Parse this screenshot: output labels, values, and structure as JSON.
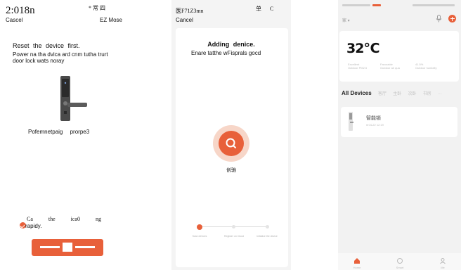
{
  "screen1": {
    "clock": "2:018n",
    "status_right": "* 常 四",
    "cancel": "Cascel",
    "mode": "EZ Mose",
    "title": "Reset the device first.",
    "description": "Power na tha dvica ard cnm tutha trurt door lock wats noray",
    "caption": "Pofemnetpaig prorpe3",
    "consent_line1": "Ca the ica0 ng",
    "consent_line2": "rapidy.",
    "accent": "#e8603a",
    "lock_icon": "door-lock-icon"
  },
  "screen2": {
    "status_left": "医F71Z3mn",
    "status_right": "单 C",
    "cancel": "Cancel",
    "title": "Adding denice.",
    "description": "Enare tatthe wFisprals gocd",
    "status_text": "创驰",
    "steps": [
      "Scan devices",
      "Register on Cloud",
      "Initialize the device"
    ],
    "progress_step": 1,
    "accent": "#e8603a"
  },
  "screen3": {
    "temperature": "32℃",
    "home_selector": "家 ▾",
    "weather": [
      {
        "value": "Excellent",
        "label": "Outdoor PM2.5"
      },
      {
        "value": "Favorable",
        "label": "Outdoor air qua"
      },
      {
        "value": "41.5%",
        "label": "Outdoor humidity"
      }
    ],
    "tabs": {
      "active": "All Devices",
      "items": [
        "客厅",
        "主卧",
        "次卧",
        "书房",
        "···"
      ]
    },
    "device": {
      "name": "智能锁",
      "status": "● 04-22 12:19"
    },
    "bottom_nav": [
      "Home",
      "Smart",
      "Me"
    ],
    "accent": "#e8603a"
  }
}
